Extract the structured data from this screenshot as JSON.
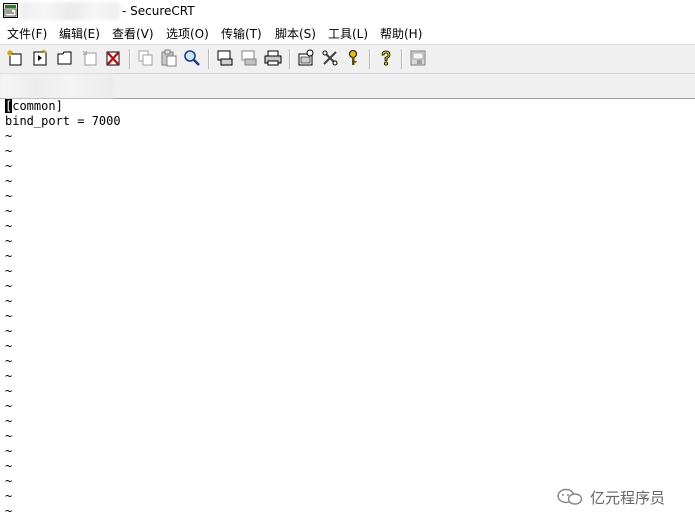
{
  "window": {
    "title": "- SecureCRT"
  },
  "menu": [
    "文件(F)",
    "编辑(E)",
    "查看(V)",
    "选项(O)",
    "传输(T)",
    "脚本(S)",
    "工具(L)",
    "帮助(H)"
  ],
  "toolbar": {
    "buttons": [
      "connect-icon",
      "quick-connect-icon",
      "connect-tab-icon",
      "reconnect-icon",
      "disconnect-icon",
      "copy-icon",
      "paste-icon",
      "find-icon",
      "print-screen-icon",
      "print-selection-icon",
      "print-icon",
      "session-options-icon",
      "global-options-icon",
      "keymap-icon",
      "help-icon",
      "sftp-icon"
    ]
  },
  "terminal": {
    "cursor_char": "[",
    "first_line_rest": "common]",
    "line2": "bind_port = 7000",
    "tilde": "~"
  },
  "watermark": {
    "text": "亿元程序员"
  }
}
